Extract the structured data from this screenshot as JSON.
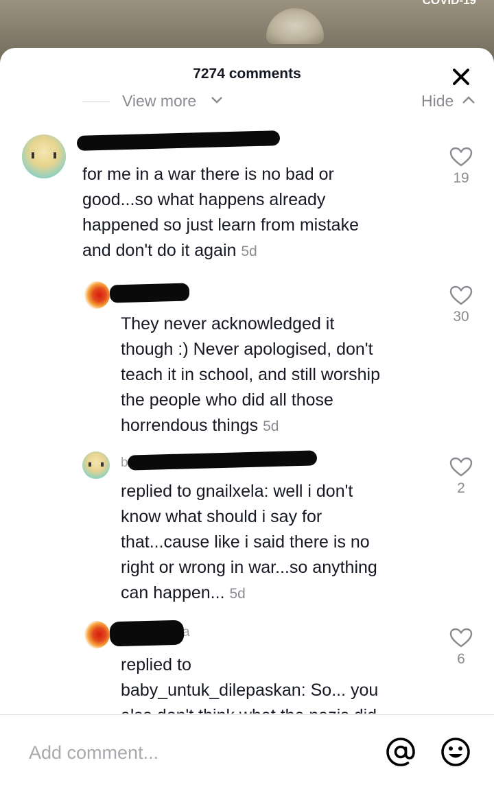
{
  "video": {
    "corner_label": "COVID-19"
  },
  "sheet": {
    "title": "7274 comments",
    "view_more_label": "View more",
    "hide_label": "Hide"
  },
  "comments": [
    {
      "username": "",
      "text": "for me in a war there is no bad or\ngood...so what happens already\nhappened so just learn from mistake\nand don't do it again",
      "reply_to": "",
      "age": "5d",
      "likes": "19"
    },
    {
      "username": "",
      "text": "They never acknowledged it\nthough :) Never apologised, don't\nteach it in school, and still worship\nthe people who did all those\nhorrendous things",
      "reply_to": "",
      "age": "5d",
      "likes": "30"
    },
    {
      "username": "bab",
      "replied_prefix": "replied to ",
      "reply_to": "gnailxela",
      "text": ": well i don't\nknow what should i say for\nthat...cause like i said there is no\nright or wrong in war...so anything\ncan happen...",
      "age": "5d",
      "likes": "2"
    },
    {
      "username": "a",
      "replied_prefix": "replied to\n",
      "reply_to": "baby_untuk_dilepaskan",
      "text": ": So... you\nalso don't think what the nazis did",
      "age": "",
      "likes": "6"
    }
  ],
  "footer": {
    "placeholder": "Add comment..."
  },
  "icons": {
    "close": "close-icon",
    "heart": "heart-outline-icon",
    "mention": "at-sign-icon",
    "emoji": "smiley-icon"
  },
  "colors": {
    "text": "#161823",
    "muted": "#8a8b91",
    "background": "#ffffff"
  }
}
